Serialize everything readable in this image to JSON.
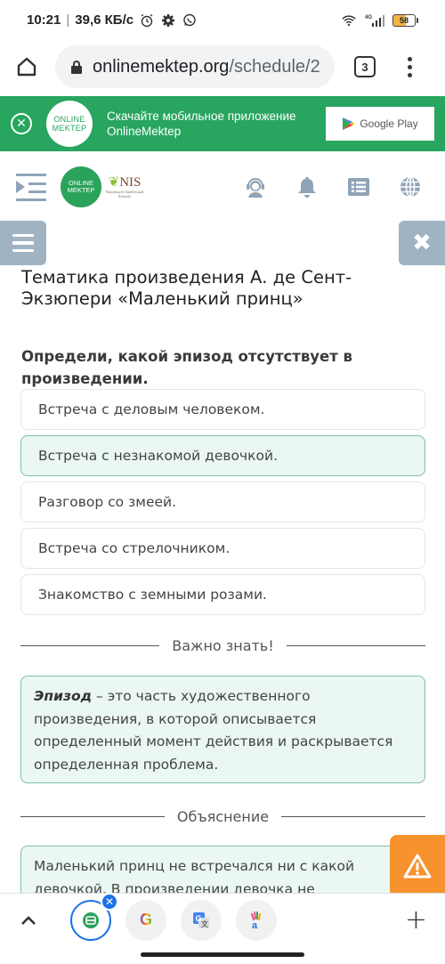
{
  "status_bar": {
    "time": "10:21",
    "speed": "39,6 КБ/с",
    "network": "4G",
    "battery": "58",
    "battery_level_percent": 58
  },
  "browser": {
    "url_host": "onlinemektep.org",
    "url_path": "/schedule/2",
    "tab_count": "3"
  },
  "banner": {
    "logo_line1": "ONLINE",
    "logo_line2": "MEKTEP",
    "text": "Скачайте мобильное приложение OnlineMektep",
    "store_label": "Google Play",
    "close_symbol": "✕"
  },
  "header": {
    "logo_line1": "ONLINE",
    "logo_line2": "MEKTEP",
    "nis_label": "NIS",
    "nis_sub": "Nazarbayev Intellectual Schools",
    "icons": [
      "support-icon",
      "bell-icon",
      "list-icon",
      "globe-icon"
    ]
  },
  "lesson": {
    "title": "Тематика произведения А. де Сент-Экзюпери «Маленький принц»",
    "question": "Определи, какой эпизод отсутствует в произведении.",
    "options": [
      {
        "label": "Встреча с деловым человеком.",
        "selected": false
      },
      {
        "label": "Встреча с незнакомой девочкой.",
        "selected": true
      },
      {
        "label": "Разговор со змеей.",
        "selected": false
      },
      {
        "label": "Встреча со стрелочником.",
        "selected": false
      },
      {
        "label": "Знакомство с земными розами.",
        "selected": false
      }
    ],
    "important_heading": "Важно знать!",
    "important_term": "Эпизод",
    "important_text": " – это часть художественного произведения, в которой описывается определенный момент действия и раскрывается определенная проблема.",
    "explanation_heading": "Объяснение",
    "explanation_text": "Маленький принц не встречался ни с какой девочкой. В произведении девочка не"
  },
  "bottom_bar": {
    "tabs": [
      {
        "name": "onlinemektep-tab",
        "active": true
      },
      {
        "name": "google-tab",
        "glyph": "G",
        "active": false
      },
      {
        "name": "google-translate-tab",
        "glyph": "G",
        "active": false
      },
      {
        "name": "hand-app-tab",
        "glyph": "a",
        "active": false
      }
    ],
    "close_badge": "✕",
    "add_symbol": "+"
  },
  "colors": {
    "brand_green": "#28a55f",
    "selected_bg": "#eaf7f2",
    "selected_border": "#7fbea6",
    "header_icon": "#8fa4b8",
    "warning_orange": "#f7922e",
    "chrome_blue": "#1a73e8"
  }
}
